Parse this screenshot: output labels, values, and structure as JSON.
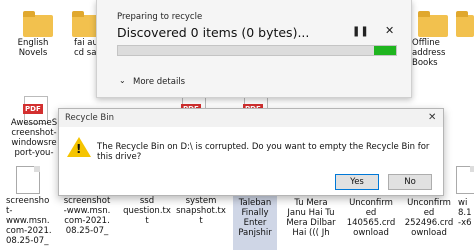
{
  "desktop": {
    "icons": [
      {
        "label": "English\nNovels",
        "type": "folder"
      },
      {
        "label": "fai aut\ncd sar",
        "type": "folder"
      },
      {
        "label": "Offline\naddress\nBooks",
        "type": "folder"
      },
      {
        "label": "AwesomeS\ncreenshot-\nwindowsre\nport-you-",
        "type": "pdf"
      },
      {
        "label": "screensho\nt-www.msn.\ncom-2021.\n08.25-07_",
        "type": "doc"
      },
      {
        "label": "screenshot\n-www.msn.\ncom-2021.\n08.25-07_",
        "type": "doc"
      },
      {
        "label": "ssd\nquestion.tx\nt",
        "type": "doc"
      },
      {
        "label": "system\nsnapshot.tx\nt",
        "type": "doc"
      },
      {
        "label": "Taleban\nFinally\nEnter\nPanjshir",
        "type": "doc"
      },
      {
        "label": "Tu Mera\nJanu Hai Tu\nMera Dilbar\nHai ((( Jh",
        "type": "doc"
      },
      {
        "label": "Unconfirm\ned\n140565.crd\nownload",
        "type": "doc"
      },
      {
        "label": "Unconfirm\ned\n252496.crd\nownload",
        "type": "doc"
      },
      {
        "label": "wi\n8.1\n-x6",
        "type": "doc"
      }
    ]
  },
  "progress_dialog": {
    "status": "Preparing to recycle",
    "summary": "Discovered 0 items (0 bytes)...",
    "pause_icon": "pause-icon",
    "close_icon": "close-icon",
    "progress_fraction": 0.08,
    "more_details": "More details",
    "colors": {
      "progress": "#1fb51f"
    }
  },
  "recycle_dialog": {
    "title": "Recycle Bin",
    "message": "The Recycle Bin on D:\\ is corrupted. Do you want to empty the Recycle Bin for this drive?",
    "yes_label": "Yes",
    "no_label": "No",
    "icon": "warning-icon"
  },
  "pdf_badge": "PDF"
}
